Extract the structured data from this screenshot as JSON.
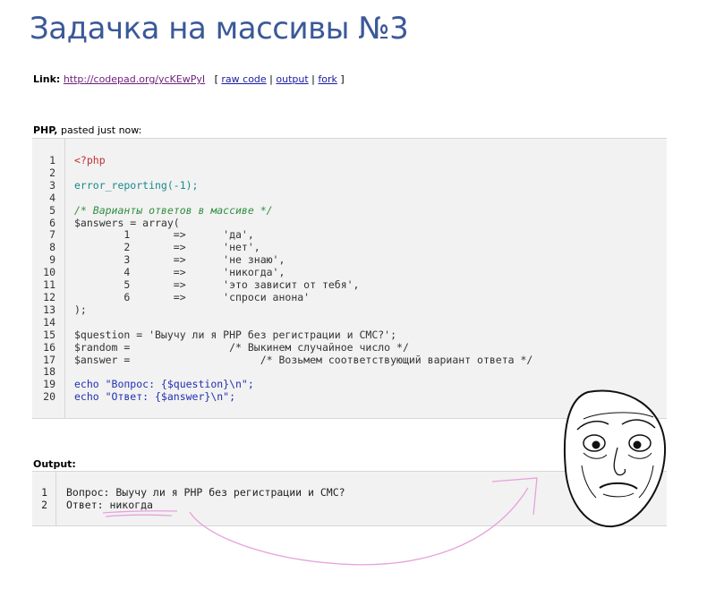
{
  "page": {
    "title": "Задачка на массивы №3"
  },
  "link": {
    "label": "Link:",
    "url": "http://codepad.org/ycKEwPyI",
    "raw_code": "raw code",
    "output": "output",
    "fork": "fork"
  },
  "paste_info": {
    "language": "PHP,",
    "time": " pasted just now:"
  },
  "code": {
    "line_numbers": "1\n2\n3\n4\n5\n6\n7\n8\n9\n10\n11\n12\n13\n14\n15\n16\n17\n18\n19\n20",
    "lines": [
      "<?php",
      "",
      "error_reporting(-1);",
      "",
      "/* Варианты ответов в массиве */",
      "$answers = array(",
      "        1       =>      'да',",
      "        2       =>      'нет',",
      "        3       =>      'не знаю',",
      "        4       =>      'никогда',",
      "        5       =>      'это зависит от тебя',",
      "        6       =>      'спроси анона'",
      ");",
      "",
      "$question = 'Выучу ли я PHP без регистрации и СМС?';",
      "$random =                /* Выкинем случайное число */",
      "$answer =                     /* Возьмем соответствующий вариант ответа */",
      "",
      "echo \"Вопрос: {$question}\\n\";",
      "echo \"Ответ: {$answer}\\n\";"
    ]
  },
  "output": {
    "label": "Output:",
    "line_numbers": "1\n2",
    "lines": [
      "Вопрос: Выучу ли я PHP без регистрации и СМС?",
      "Ответ: никогда"
    ]
  },
  "colors": {
    "title": "#3b5998",
    "keyword": "#2030b0",
    "string": "#b8860b",
    "comment": "#2f8f3f",
    "annotation": "#e7a2dc"
  },
  "decorations": {
    "meme_face": "okay-face-meme-icon",
    "arrow": "pink-hand-drawn-arrow"
  }
}
